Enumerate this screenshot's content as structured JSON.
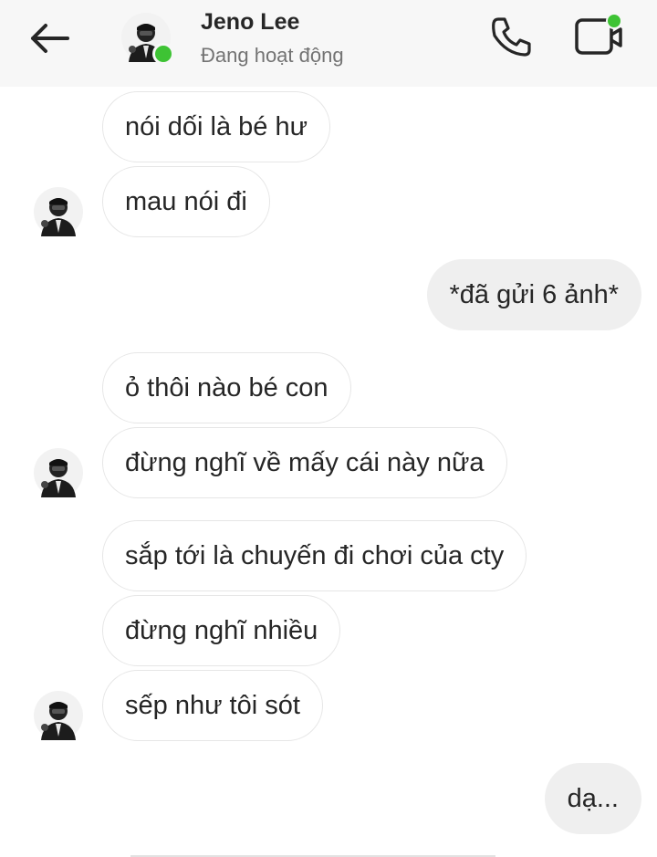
{
  "header": {
    "name": "Jeno Lee",
    "status": "Đang hoạt động",
    "back_icon": "arrow-left-icon",
    "call_icon": "phone-icon",
    "video_icon": "video-call-icon",
    "online_color": "#3ec334"
  },
  "messages": [
    {
      "direction": "in",
      "text": "nói dối là bé hư",
      "avatar": false
    },
    {
      "direction": "in",
      "text": "mau nói đi",
      "avatar": true
    },
    {
      "direction": "out",
      "text": "*đã gửi 6 ảnh*"
    },
    {
      "direction": "in",
      "text": "ỏ thôi nào bé con",
      "avatar": false
    },
    {
      "direction": "in",
      "text": "đừng nghĩ về mấy cái này nữa",
      "avatar": true
    },
    {
      "direction": "in",
      "text": "sắp tới là chuyến đi chơi của cty",
      "avatar": false
    },
    {
      "direction": "in",
      "text": "đừng nghĩ nhiều",
      "avatar": false
    },
    {
      "direction": "in",
      "text": "sếp như tôi sót",
      "avatar": true
    },
    {
      "direction": "out",
      "text": "dạ..."
    }
  ]
}
